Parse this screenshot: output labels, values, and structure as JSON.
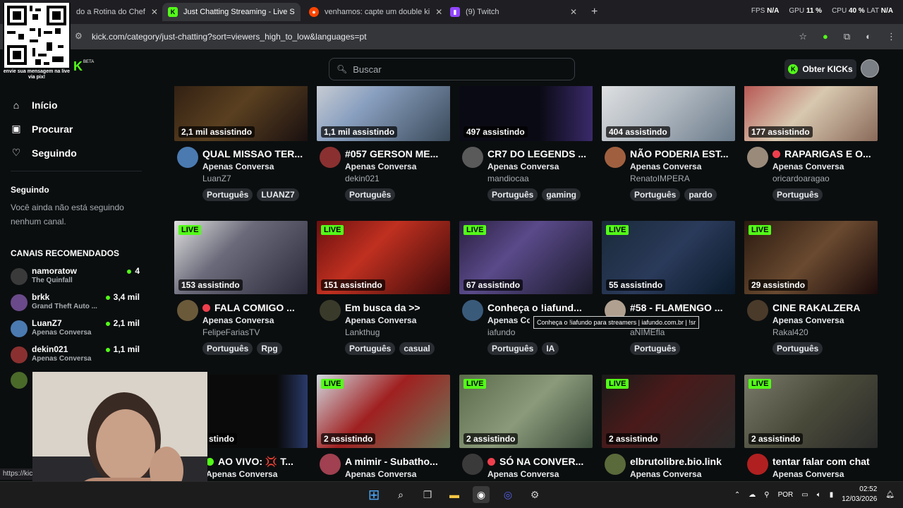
{
  "browser": {
    "tabs": [
      {
        "title": "do a Rotina do Chef",
        "active": false
      },
      {
        "title": "Just Chatting Streaming - Live S",
        "active": true
      },
      {
        "title": "venhamos: capte um double ki",
        "active": false
      },
      {
        "title": "(9) Twitch",
        "active": false
      }
    ],
    "url": "kick.com/category/just-chatting?sort=viewers_high_to_low&languages=pt",
    "stats": {
      "fps_label": "FPS",
      "fps": "N/A",
      "gpu_label": "GPU",
      "gpu": "11 %",
      "cpu_label": "CPU",
      "cpu": "40 %",
      "lat_label": "LAT",
      "lat": "N/A"
    }
  },
  "overlay": {
    "qr_caption": "envie sua mensagem na live via pix!"
  },
  "header": {
    "logo": "K",
    "beta": "BETA",
    "search_placeholder": "Buscar",
    "kicks_button": "Obter KICKs"
  },
  "sidebar": {
    "nav": [
      {
        "label": "Início",
        "icon": "home-icon"
      },
      {
        "label": "Procurar",
        "icon": "browse-icon"
      },
      {
        "label": "Seguindo",
        "icon": "heart-icon"
      }
    ],
    "following_title": "Seguindo",
    "following_empty": "Você ainda não está seguindo nenhum canal.",
    "recommended_title": "CANAIS RECOMENDADOS",
    "recommended": [
      {
        "name": "namoratow",
        "category": "The Quinfall",
        "viewers": "4"
      },
      {
        "name": "brkk",
        "category": "Grand Theft Auto ...",
        "viewers": "3,4 mil"
      },
      {
        "name": "LuanZ7",
        "category": "Apenas Conversa",
        "viewers": "2,1 mil"
      },
      {
        "name": "dekin021",
        "category": "Apenas Conversa",
        "viewers": "1,1 mil"
      }
    ]
  },
  "streams_row1": [
    {
      "viewers": "2,1 mil assistindo",
      "title": "QUAL MISSAO TER...",
      "category": "Apenas Conversa",
      "channel": "LuanZ7",
      "tags": [
        "Português",
        "LUANZ7"
      ],
      "live_dot": false
    },
    {
      "viewers": "1,1 mil assistindo",
      "title": "#057 GERSON ME...",
      "category": "Apenas Conversa",
      "channel": "dekin021",
      "tags": [
        "Português"
      ],
      "live_dot": false
    },
    {
      "viewers": "497 assistindo",
      "title": "CR7 DO LEGENDS ...",
      "category": "Apenas Conversa",
      "channel": "mandiocaa",
      "tags": [
        "Português",
        "gaming"
      ],
      "live_dot": false
    },
    {
      "viewers": "404 assistindo",
      "title": "NÃO PODERIA EST...",
      "category": "Apenas Conversa",
      "channel": "RenatoIMPERA",
      "tags": [
        "Português",
        "pardo"
      ],
      "live_dot": false
    },
    {
      "viewers": "177 assistindo",
      "title": "RAPARIGAS E O...",
      "category": "Apenas Conversa",
      "channel": "oricardoaragao",
      "tags": [
        "Português"
      ],
      "live_dot": true
    }
  ],
  "streams_row2": [
    {
      "live": "LIVE",
      "viewers": "153 assistindo",
      "title": "FALA COMIGO ...",
      "category": "Apenas Conversa",
      "channel": "FelipeFariasTV",
      "tags": [
        "Português",
        "Rpg"
      ],
      "live_dot": true
    },
    {
      "live": "LIVE",
      "viewers": "151 assistindo",
      "title": "Em busca da >>",
      "category": "Apenas Conversa",
      "channel": "Lankthug",
      "tags": [
        "Português",
        "casual"
      ],
      "live_dot": false
    },
    {
      "live": "LIVE",
      "viewers": "67 assistindo",
      "title": "Conheça o !iafund...",
      "category": "Apenas Co",
      "channel": "iafundo",
      "tags": [
        "Português",
        "IA"
      ],
      "live_dot": false
    },
    {
      "live": "LIVE",
      "viewers": "55 assistindo",
      "title": "#58 - FLAMENGO ...",
      "category": "",
      "channel": "aNIMEfla",
      "tags": [
        "Português"
      ],
      "live_dot": false
    },
    {
      "live": "LIVE",
      "viewers": "29 assistindo",
      "title": "CINE RAKALZERA",
      "category": "Apenas Conversa",
      "channel": "Rakal420",
      "tags": [
        "Português"
      ],
      "live_dot": false
    }
  ],
  "streams_row3": [
    {
      "live": "",
      "viewers": "stindo",
      "title": "AO VIVO: 💢 T...",
      "category": "Apenas Conversa",
      "live_dot": true
    },
    {
      "live": "LIVE",
      "viewers": "2 assistindo",
      "title": "A mimir - Subatho...",
      "category": "Apenas Conversa",
      "live_dot": false
    },
    {
      "live": "LIVE",
      "viewers": "2 assistindo",
      "title": "SÓ NA CONVER...",
      "category": "Apenas Conversa",
      "live_dot": true
    },
    {
      "live": "LIVE",
      "viewers": "2 assistindo",
      "title": "elbrutolibre.bio.link",
      "category": "Apenas Conversa",
      "live_dot": false
    },
    {
      "live": "LIVE",
      "viewers": "2 assistindo",
      "title": "tentar falar com chat",
      "category": "Apenas Conversa",
      "live_dot": false
    }
  ],
  "tooltip": "Conheça o !iafundo para streamers | iafundo.com.br | !sr",
  "status_url": "https://kic",
  "taskbar": {
    "lang": "POR",
    "time": "02:52",
    "date": "12/03/2026"
  },
  "colors": {
    "accent": "#53fc18",
    "background": "#0b0e0f",
    "live_red": "#ef3f4d"
  }
}
